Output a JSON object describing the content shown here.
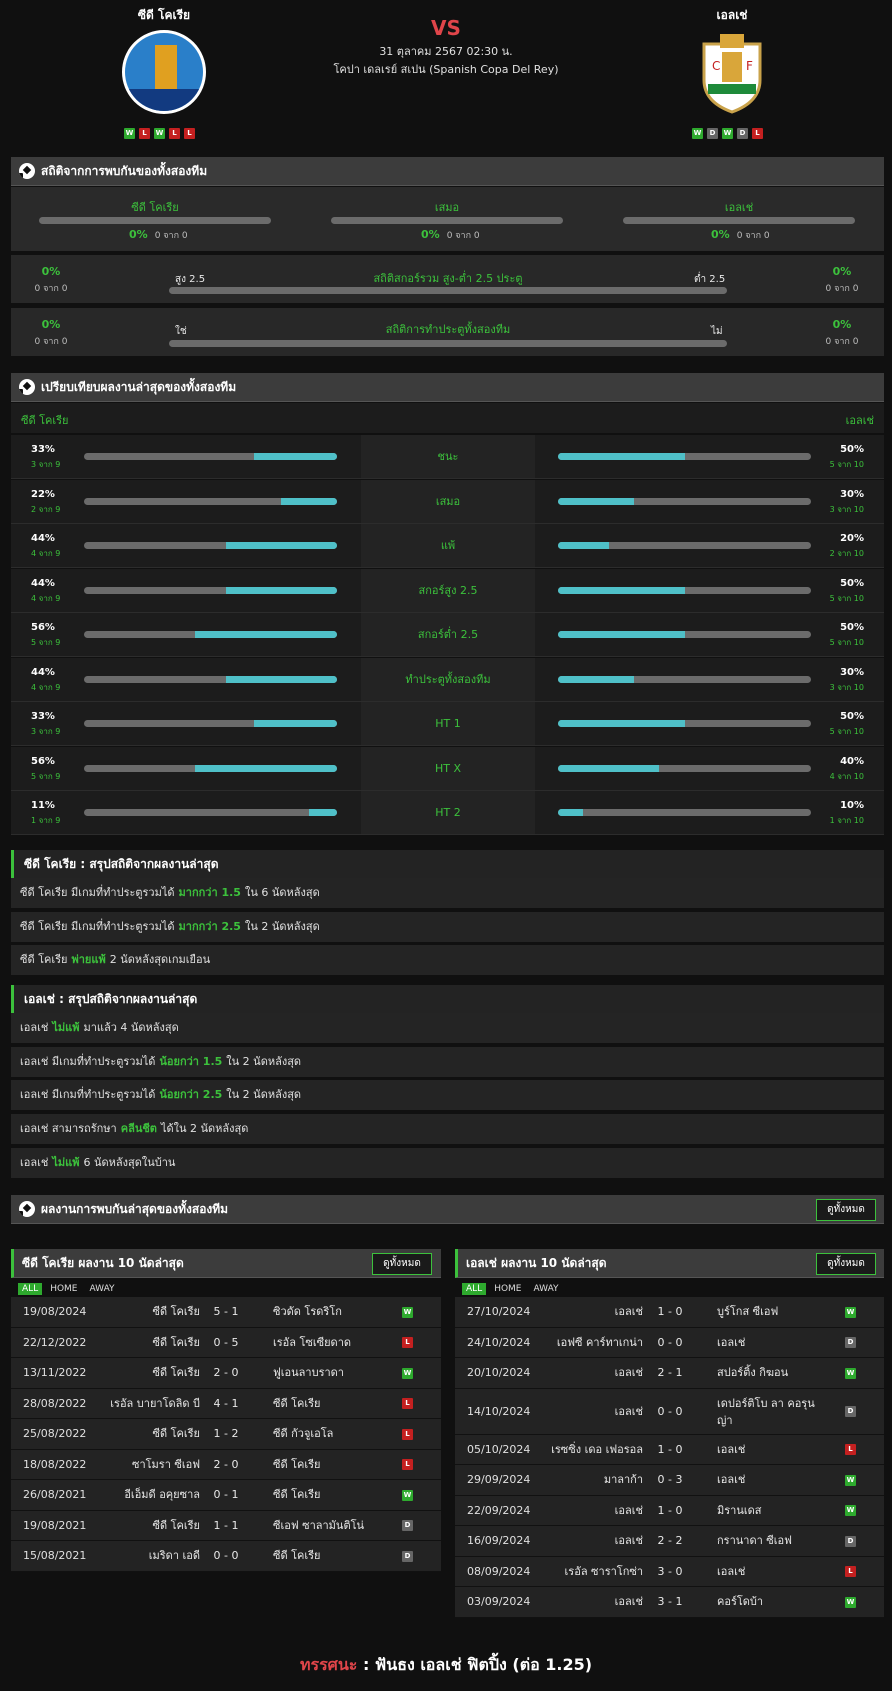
{
  "home_team": {
    "name": "ซีดี โคเรีย",
    "form": [
      "W",
      "L",
      "W",
      "L",
      "L"
    ]
  },
  "away_team": {
    "name": "เอลเช่",
    "form": [
      "W",
      "D",
      "W",
      "D",
      "L"
    ]
  },
  "vs": "VS",
  "match_date": "31 ตุลาคม 2567 02:30 น.",
  "competition": "โคปา เดลเรย์ สเปน (Spanish Copa Del Rey)",
  "colors": {
    "accent": "#3cc13c",
    "bar_fill": "#4fc0c8",
    "win": "#2eaa2e",
    "loss": "#c42020",
    "draw": "#666666",
    "vs": "#e0454a"
  },
  "h2h": {
    "title": "สถิติจากการพบกันของทั้งสองทีม",
    "cols": [
      {
        "label": "ซีดี โคเรีย",
        "pct": "0%",
        "count": "0 จาก 0"
      },
      {
        "label": "เสมอ",
        "pct": "0%",
        "count": "0 จาก 0"
      },
      {
        "label": "เอลเช่",
        "pct": "0%",
        "count": "0 จาก 0"
      }
    ],
    "ou": {
      "title": "สถิติสกอร์รวม สูง-ต่ำ 2.5 ประตู",
      "left_label": "สูง 2.5",
      "right_label": "ต่ำ 2.5",
      "left_pct": "0%",
      "left_count": "0 จาก 0",
      "right_pct": "0%",
      "right_count": "0 จาก 0"
    },
    "btts": {
      "title": "สถิติการทำประตูทั้งสองทีม",
      "left_label": "ใช่",
      "right_label": "ไม่",
      "left_pct": "0%",
      "left_count": "0 จาก 0",
      "right_pct": "0%",
      "right_count": "0 จาก 0"
    }
  },
  "compare": {
    "title": "เปรียบเทียบผลงานล่าสุดของทั้งสองทีม",
    "home_label": "ซีดี โคเรีย",
    "away_label": "เอลเช่",
    "rows": [
      {
        "label": "ชนะ",
        "h_pct": "33%",
        "h_count": "3 จาก 9",
        "h_frac": 0.33,
        "a_pct": "50%",
        "a_count": "5 จาก 10",
        "a_frac": 0.5
      },
      {
        "label": "เสมอ",
        "h_pct": "22%",
        "h_count": "2 จาก 9",
        "h_frac": 0.22,
        "a_pct": "30%",
        "a_count": "3 จาก 10",
        "a_frac": 0.3
      },
      {
        "label": "แพ้",
        "h_pct": "44%",
        "h_count": "4 จาก 9",
        "h_frac": 0.44,
        "a_pct": "20%",
        "a_count": "2 จาก 10",
        "a_frac": 0.2
      },
      {
        "label": "สกอร์สูง 2.5",
        "h_pct": "44%",
        "h_count": "4 จาก 9",
        "h_frac": 0.44,
        "a_pct": "50%",
        "a_count": "5 จาก 10",
        "a_frac": 0.5
      },
      {
        "label": "สกอร์ต่ำ 2.5",
        "h_pct": "56%",
        "h_count": "5 จาก 9",
        "h_frac": 0.56,
        "a_pct": "50%",
        "a_count": "5 จาก 10",
        "a_frac": 0.5
      },
      {
        "label": "ทำประตูทั้งสองทีม",
        "h_pct": "44%",
        "h_count": "4 จาก 9",
        "h_frac": 0.44,
        "a_pct": "30%",
        "a_count": "3 จาก 10",
        "a_frac": 0.3
      },
      {
        "label": "HT 1",
        "h_pct": "33%",
        "h_count": "3 จาก 9",
        "h_frac": 0.33,
        "a_pct": "50%",
        "a_count": "5 จาก 10",
        "a_frac": 0.5
      },
      {
        "label": "HT X",
        "h_pct": "56%",
        "h_count": "5 จาก 9",
        "h_frac": 0.56,
        "a_pct": "40%",
        "a_count": "4 จาก 10",
        "a_frac": 0.4
      },
      {
        "label": "HT 2",
        "h_pct": "11%",
        "h_count": "1 จาก 9",
        "h_frac": 0.11,
        "a_pct": "10%",
        "a_count": "1 จาก 10",
        "a_frac": 0.1
      }
    ]
  },
  "home_summary": {
    "title": "ซีดี โคเรีย : สรุปสถิติจากผลงานล่าสุด",
    "rows": [
      {
        "pre": "ซีดี โคเรีย  มีเกมที่ทำประตูรวมได้",
        "hl": "มากกว่า  1.5",
        "post": "ใน 6 นัดหลังสุด"
      },
      {
        "pre": "ซีดี โคเรีย  มีเกมที่ทำประตูรวมได้",
        "hl": "มากกว่า  2.5",
        "post": "ใน 2 นัดหลังสุด"
      },
      {
        "pre": "ซีดี โคเรีย",
        "hl": "พ่ายแพ้",
        "post": "2  นัดหลังสุดเกมเยือน"
      }
    ]
  },
  "away_summary": {
    "title": "เอลเช่ : สรุปสถิติจากผลงานล่าสุด",
    "rows": [
      {
        "pre": "เอลเช่",
        "hl": "ไม่แพ้",
        "post": "มาแล้ว 4 นัดหลังสุด"
      },
      {
        "pre": "เอลเช่  มีเกมที่ทำประตูรวมได้",
        "hl": "น้อยกว่า  1.5",
        "post": "ใน 2 นัดหลังสุด"
      },
      {
        "pre": "เอลเช่  มีเกมที่ทำประตูรวมได้",
        "hl": "น้อยกว่า  2.5",
        "post": "ใน 2 นัดหลังสุด"
      },
      {
        "pre": "เอลเช่  สามารถรักษา",
        "hl": "คลีนชีต",
        "post": "ได้ใน 2 นัดหลังสุด"
      },
      {
        "pre": "เอลเช่",
        "hl": "ไม่แพ้",
        "post": "6  นัดหลังสุดในบ้าน"
      }
    ]
  },
  "recent_h2h": {
    "title": "ผลงานการพบกันล่าสุดของทั้งสองทีม",
    "view_all": "ดูทั้งหมด"
  },
  "tabs": [
    "ALL",
    "HOME",
    "AWAY"
  ],
  "home_last10": {
    "title": "ซีดี โคเรีย ผลงาน 10 นัดล่าสุด",
    "view_all": "ดูทั้งหมด",
    "matches": [
      {
        "date": "19/08/2024",
        "home": "ซีดี โคเรีย",
        "score": "5 - 1",
        "away": "ซิวดัด โรดริโก",
        "res": "W"
      },
      {
        "date": "22/12/2022",
        "home": "ซีดี โคเรีย",
        "score": "0 - 5",
        "away": "เรอัล โซเซียดาด",
        "res": "L"
      },
      {
        "date": "13/11/2022",
        "home": "ซีดี โคเรีย",
        "score": "2 - 0",
        "away": "ฟูเอนลาบราดา",
        "res": "W"
      },
      {
        "date": "28/08/2022",
        "home": "เรอัล บายาโดลิด บี",
        "score": "4 - 1",
        "away": "ซีดี โคเรีย",
        "res": "L"
      },
      {
        "date": "25/08/2022",
        "home": "ซีดี โคเรีย",
        "score": "1 - 2",
        "away": "ซีดี กัวจูเอโล",
        "res": "L"
      },
      {
        "date": "18/08/2022",
        "home": "ซาโมรา ซีเอฟ",
        "score": "2 - 0",
        "away": "ซีดี โคเรีย",
        "res": "L"
      },
      {
        "date": "26/08/2021",
        "home": "อีเอ็มดี อคุยซาล",
        "score": "0 - 1",
        "away": "ซีดี โคเรีย",
        "res": "W"
      },
      {
        "date": "19/08/2021",
        "home": "ซีดี โคเรีย",
        "score": "1 - 1",
        "away": "ซีเอฟ ซาลามันติโน่",
        "res": "D"
      },
      {
        "date": "15/08/2021",
        "home": "เมริดา เอดี",
        "score": "0 - 0",
        "away": "ซีดี โคเรีย",
        "res": "D"
      }
    ]
  },
  "away_last10": {
    "title": "เอลเช่ ผลงาน 10 นัดล่าสุด",
    "view_all": "ดูทั้งหมด",
    "matches": [
      {
        "date": "27/10/2024",
        "home": "เอลเช่",
        "score": "1 - 0",
        "away": "บูร์โกส ซีเอฟ",
        "res": "W"
      },
      {
        "date": "24/10/2024",
        "home": "เอฟซี คาร์ทาเกน่า",
        "score": "0 - 0",
        "away": "เอลเช่",
        "res": "D"
      },
      {
        "date": "20/10/2024",
        "home": "เอลเช่",
        "score": "2 - 1",
        "away": "สปอร์ติ้ง กิฆอน",
        "res": "W"
      },
      {
        "date": "14/10/2024",
        "home": "เอลเช่",
        "score": "0 - 0",
        "away": "เดปอร์ติโบ ลา คอรุนญ่า",
        "res": "D"
      },
      {
        "date": "05/10/2024",
        "home": "เรซซิ่ง เดอ เฟอรอล",
        "score": "1 - 0",
        "away": "เอลเช่",
        "res": "L"
      },
      {
        "date": "29/09/2024",
        "home": "มาลาก้า",
        "score": "0 - 3",
        "away": "เอลเช่",
        "res": "W"
      },
      {
        "date": "22/09/2024",
        "home": "เอลเช่",
        "score": "1 - 0",
        "away": "มิรานเดส",
        "res": "W"
      },
      {
        "date": "16/09/2024",
        "home": "เอลเช่",
        "score": "2 - 2",
        "away": "กรานาดา ซีเอฟ",
        "res": "D"
      },
      {
        "date": "08/09/2024",
        "home": "เรอัล ซาราโกซ่า",
        "score": "3 - 0",
        "away": "เอลเช่",
        "res": "L"
      },
      {
        "date": "03/09/2024",
        "home": "เอลเช่",
        "score": "3 - 1",
        "away": "คอร์โดบ้า",
        "res": "W"
      }
    ]
  },
  "verdict": {
    "label": "ทรรศนะ",
    "sep": ":",
    "text": "ฟันธง เอลเช่ ฟิตปิ้ง (ต่อ 1.25)"
  }
}
